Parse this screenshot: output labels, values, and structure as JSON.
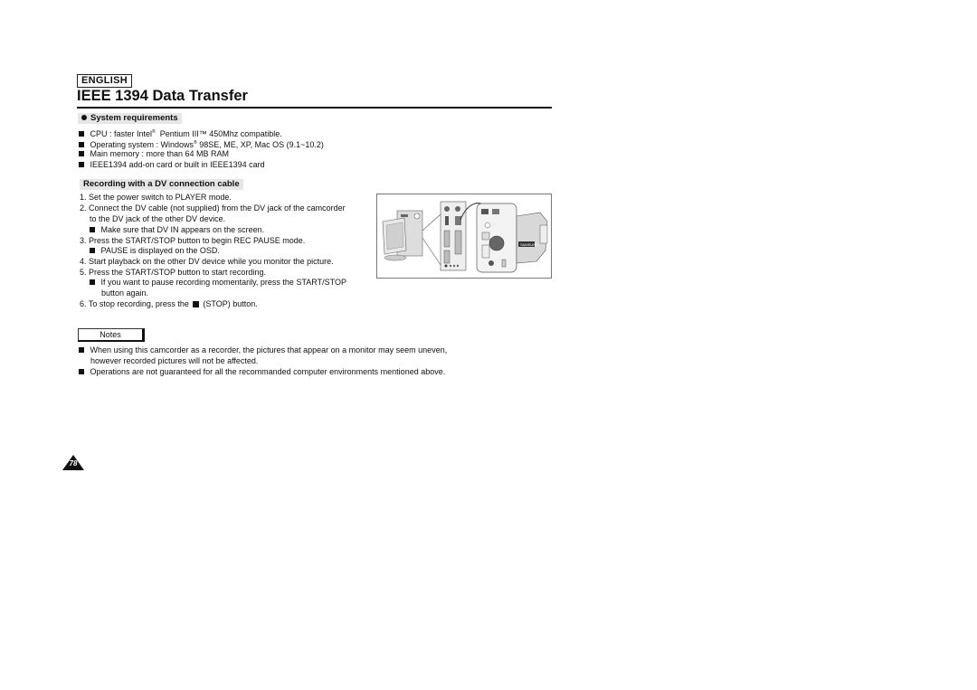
{
  "header": {
    "language_label": "ENGLISH",
    "title": "IEEE 1394 Data Transfer"
  },
  "system_requirements": {
    "heading": "System requirements",
    "items": [
      {
        "pre": "CPU : faster Intel",
        "sup": "®",
        "post": "  Pentium III™ 450Mhz compatible."
      },
      {
        "pre": "Operating system : Windows",
        "sup": "®",
        "post": " 98SE, ME, XP, Mac OS (9.1~10.2)"
      },
      {
        "pre": "Main memory : more than 64 MB RAM",
        "sup": "",
        "post": ""
      },
      {
        "pre": "IEEE1394 add-on card or built in IEEE1394 card",
        "sup": "",
        "post": ""
      }
    ]
  },
  "recording": {
    "heading": "Recording with a DV connection cable",
    "steps": [
      {
        "num": "1.",
        "text": "Set the power switch to PLAYER mode."
      },
      {
        "num": "2.",
        "text": "Connect the DV cable (not supplied) from the DV jack of the camcorder",
        "cont": "to the DV jack of the other DV device."
      },
      {
        "bullet": "Make sure that DV IN appears on the screen."
      },
      {
        "num": "3.",
        "text": "Press the START/STOP button to begin REC PAUSE mode."
      },
      {
        "bullet": "PAUSE is displayed on the OSD."
      },
      {
        "num": "4.",
        "text": "Start playback on the other DV device while you monitor the picture."
      },
      {
        "num": "5.",
        "text": "Press the START/STOP button to start recording."
      },
      {
        "bullet": "If you want to pause recording momentarily, press the START/STOP",
        "cont": "button again."
      },
      {
        "num": "6.",
        "text_pre": "To stop recording, press the ",
        "text_post": " (STOP) button."
      }
    ]
  },
  "illustration": {
    "description": "PC connected via DV cable to camcorder DV jack",
    "camcorder_brand": "SAMSUNG"
  },
  "notes": {
    "label": "Notes",
    "items": [
      {
        "text": "When using this camcorder as a recorder, the pictures that appear on a monitor may seem uneven,",
        "cont": "however recorded pictures will not be affected."
      },
      {
        "text": "Operations are not guaranteed for all the recommanded computer environments mentioned above."
      }
    ]
  },
  "page_number": "78"
}
